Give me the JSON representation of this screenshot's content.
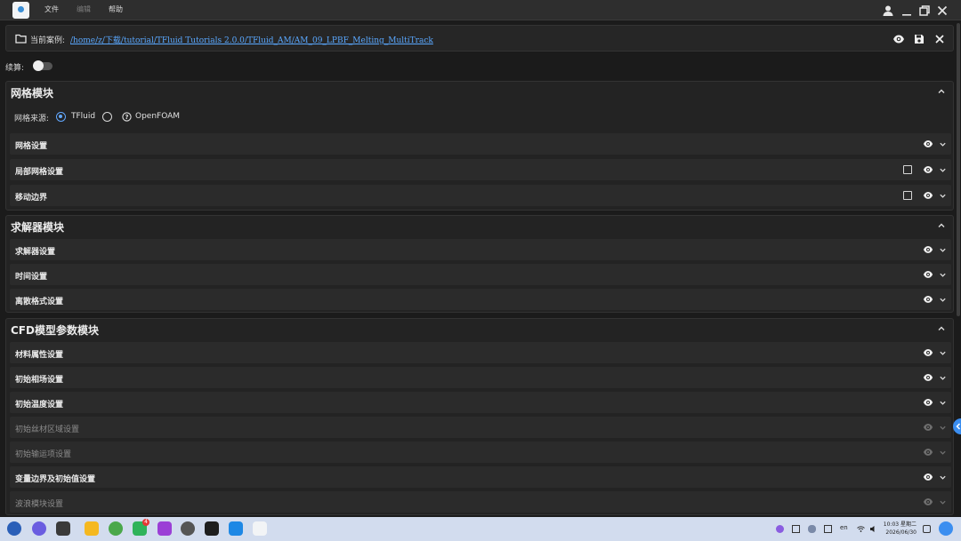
{
  "menu": [
    "文件",
    "编辑",
    "帮助"
  ],
  "case": {
    "label": "当前案例:",
    "path": "/home/z/下载/tutorial/TFluid Tutorials 2.0.0/TFluid_AM/AM_09_LPBF_Melting_MultiTrack"
  },
  "continue_label": "续算:",
  "mesh": {
    "title": "网格模块",
    "source_label": "网格来源:",
    "options": [
      "TFluid",
      "OpenFOAM"
    ],
    "rows": [
      "网格设置",
      "局部网格设置",
      "移动边界"
    ]
  },
  "solver": {
    "title": "求解器模块",
    "rows": [
      "求解器设置",
      "时间设置",
      "离散格式设置"
    ]
  },
  "cfd": {
    "title": "CFD模型参数模块",
    "rows": [
      "材料属性设置",
      "初始相场设置",
      "初始温度设置",
      "初始丝材区域设置",
      "初始输运项设置",
      "变量边界及初始值设置",
      "波浪模块设置"
    ]
  },
  "taskbar": {
    "badge": "4",
    "time": "10:03 星期二",
    "date": "2026/06/30",
    "lang": "en"
  },
  "colors": {
    "accent": "#62a8ff",
    "link": "#5aa8ff",
    "background": "#1b1b1b"
  }
}
